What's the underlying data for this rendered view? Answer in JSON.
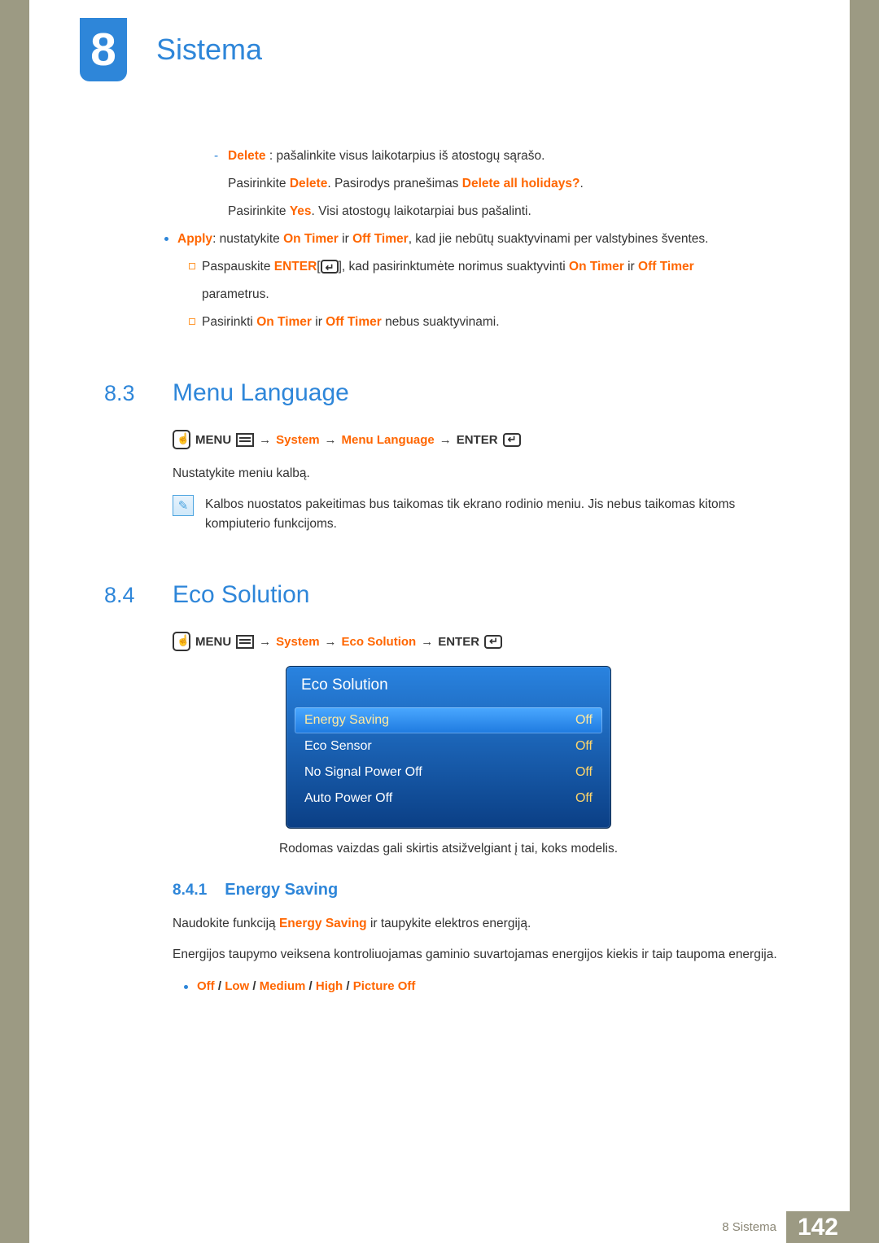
{
  "chapter": {
    "number": "8",
    "title": "Sistema"
  },
  "intro": {
    "delete_label": "Delete",
    "delete_desc": " : pašalinkite visus laikotarpius iš atostogų sąrašo.",
    "l2a": "Pasirinkite ",
    "l2b": "Delete",
    "l2c": ". Pasirodys pranešimas ",
    "l2d": "Delete all holidays?",
    "l2e": ".",
    "l3a": "Pasirinkite ",
    "l3b": "Yes",
    "l3c": ". Visi atostogų laikotarpiai bus pašalinti.",
    "apply_label": "Apply",
    "apply_a": ": nustatykite ",
    "apply_on": "On Timer",
    "apply_mid": " ir ",
    "apply_off": "Off Timer",
    "apply_b": ", kad jie nebūtų suaktyvinami per valstybines šventes.",
    "sq1a": "Paspauskite ",
    "sq1_enter": "ENTER",
    "sq1b": "[",
    "sq1c": "], kad pasirinktumėte norimus suaktyvinti ",
    "sq1d": " parametrus.",
    "sq2a": "Pasirinkti ",
    "sq2b": " nebus suaktyvinami."
  },
  "s83": {
    "num": "8.3",
    "title": "Menu Language",
    "nav": {
      "menu": "MENU",
      "system": "System",
      "page": "Menu Language",
      "enter": "ENTER",
      "arrow": "→"
    },
    "body1": "Nustatykite meniu kalbą.",
    "note": "Kalbos nuostatos pakeitimas bus taikomas tik ekrano rodinio meniu. Jis nebus taikomas kitoms kompiuterio funkcijoms."
  },
  "s84": {
    "num": "8.4",
    "title": "Eco Solution",
    "nav": {
      "menu": "MENU",
      "system": "System",
      "page": "Eco Solution",
      "enter": "ENTER",
      "arrow": "→"
    },
    "osd": {
      "title": "Eco Solution",
      "rows": [
        {
          "label": "Energy Saving",
          "value": "Off"
        },
        {
          "label": "Eco Sensor",
          "value": "Off"
        },
        {
          "label": "No Signal Power Off",
          "value": "Off"
        },
        {
          "label": "Auto Power Off",
          "value": "Off"
        }
      ]
    },
    "caption": "Rodomas vaizdas gali skirtis atsižvelgiant į tai, koks modelis.",
    "sub": {
      "num": "8.4.1",
      "title": "Energy Saving"
    },
    "p1a": "Naudokite funkciją ",
    "p1b": "Energy Saving",
    "p1c": " ir taupykite elektros energiją.",
    "p2": "Energijos taupymo veiksena kontroliuojamas gaminio suvartojamas energijos kiekis ir taip taupoma energija.",
    "opts": {
      "off": "Off",
      "low": "Low",
      "med": "Medium",
      "high": "High",
      "pic": "Picture Off",
      "sep": " / "
    }
  },
  "footer": {
    "label": "8 Sistema",
    "page": "142"
  }
}
